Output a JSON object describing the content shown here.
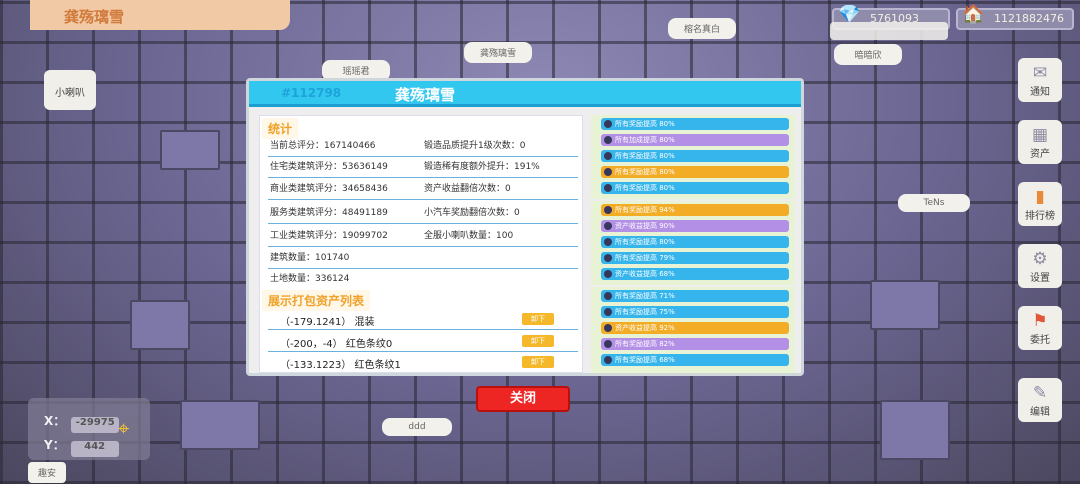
{
  "top_bar": {
    "title": "龚殇璃雪"
  },
  "resources": [
    {
      "icon": "diamond-icon",
      "value": "5761093"
    },
    {
      "icon": "gold-ingot-icon",
      "value": "1121882476"
    }
  ],
  "map_tags": [
    "榕名真白",
    "龚殇璃雪",
    "瑶瑶君",
    "暗暗欣",
    "TeNs",
    "ddd",
    "趣安"
  ],
  "left_button": "小喇叭",
  "side_menu": [
    {
      "label": "通知",
      "icon": "bell-icon"
    },
    {
      "label": "资产",
      "icon": "building-icon"
    },
    {
      "label": "排行榜",
      "icon": "ranking-icon"
    },
    {
      "label": "设置",
      "icon": "gear-icon"
    },
    {
      "label": "委托",
      "icon": "commission-icon"
    },
    {
      "label": "编辑",
      "icon": "edit-icon"
    }
  ],
  "coords": {
    "x_label": "X：",
    "x": "-29975",
    "y_label": "Y：",
    "y": "442"
  },
  "panel": {
    "id": "#112798",
    "name": "龚殇璃雪",
    "stats_label": "统计",
    "stats": [
      [
        "当前总评分：167140466",
        "锻造品质提升1级次数：0"
      ],
      [
        "住宅类建筑评分：53636149",
        "锻造稀有度额外提升：191%"
      ],
      [
        "商业类建筑评分：34658436",
        "资产收益翻倍次数：0"
      ],
      [
        "服务类建筑评分：48491189",
        "小汽车奖励翻倍次数：0"
      ],
      [
        "工业类建筑评分：19099702",
        "全服小喇叭数量：100"
      ],
      [
        "建筑数量：101740",
        ""
      ],
      [
        "土地数量：336124",
        ""
      ]
    ],
    "assets_label": "展示打包资产列表",
    "assets": [
      {
        "coord": "（-179.1241）",
        "name": "混装",
        "button": "卸下"
      },
      {
        "coord": "（-200，-4）",
        "name": "红色条纹0",
        "button": "卸下"
      },
      {
        "coord": "（-133.1223）",
        "name": "红色条纹1",
        "button": "卸下"
      }
    ],
    "bonus_groups": [
      [
        {
          "text": "所有奖励提高 80%",
          "color": "#35b5ec"
        },
        {
          "text": "所有加成提高 80%",
          "color": "#b38fe6"
        },
        {
          "text": "所有奖励提高 80%",
          "color": "#35b5ec"
        },
        {
          "text": "所有奖励提高 80%",
          "color": "#f2ac26"
        },
        {
          "text": "所有奖励提高 80%",
          "color": "#35b5ec"
        }
      ],
      [
        {
          "text": "所有奖励提高 94%",
          "color": "#f2ac26"
        },
        {
          "text": "资产收益提高 90%",
          "color": "#b38fe6"
        },
        {
          "text": "所有奖励提高 80%",
          "color": "#35b5ec"
        },
        {
          "text": "所有奖励提高 79%",
          "color": "#35b5ec"
        },
        {
          "text": "资产收益提高 68%",
          "color": "#35b5ec"
        }
      ],
      [
        {
          "text": "所有奖励提高 71%",
          "color": "#35b5ec"
        },
        {
          "text": "所有奖励提高 75%",
          "color": "#35b5ec"
        },
        {
          "text": "资产收益提高 92%",
          "color": "#f2ac26"
        },
        {
          "text": "所有奖励提高 82%",
          "color": "#b38fe6"
        },
        {
          "text": "所有奖励提高 68%",
          "color": "#35b5ec"
        }
      ]
    ],
    "close_label": "关闭"
  }
}
